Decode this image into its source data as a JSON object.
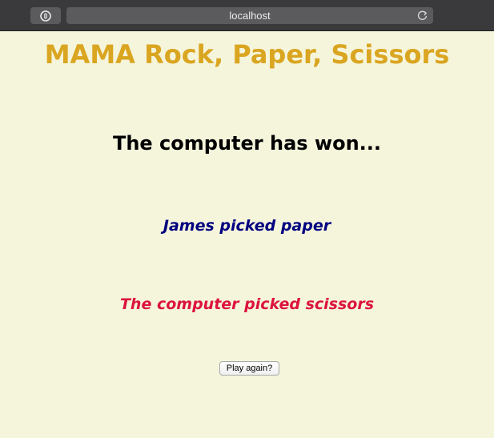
{
  "browser": {
    "address": "localhost"
  },
  "game": {
    "title": "MAMA Rock, Paper, Scissors",
    "result": "The computer has won...",
    "player_pick": "James picked paper",
    "computer_pick": "The computer picked scissors",
    "play_again_label": "Play again?"
  },
  "colors": {
    "background": "#f5f5dc",
    "title": "#daa520",
    "player": "#000080",
    "computer": "#dc143c"
  },
  "icons": {
    "privacy": "privacy-report-icon",
    "reload": "reload-icon"
  }
}
